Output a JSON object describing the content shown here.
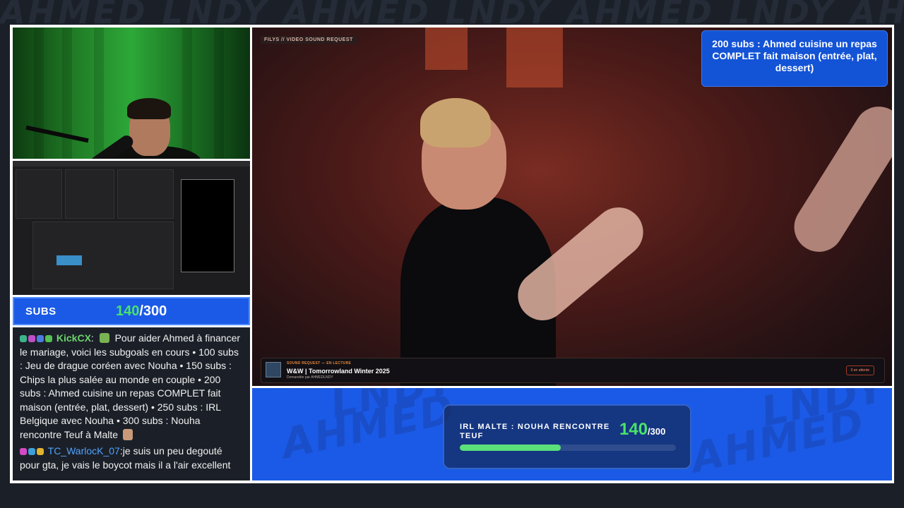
{
  "background_watermark": "AHMED LNDY AHMED LNDY AHMED LNDY AHMED",
  "video_tag": "FILYS // VIDEO SOUND REQUEST",
  "subgoal_popup": "200 subs : Ahmed cuisine un repas COMPLET fait maison (entrée, plat, dessert)",
  "song": {
    "kicker": "SOUND REQUEST — EN LECTURE",
    "title": "W&W | Tomorrowland Winter 2025",
    "requested_by": "Demandée par AHMEDLNDY",
    "status": "0 en attente"
  },
  "subs": {
    "label": "SUBS",
    "current": "140",
    "total": "/300"
  },
  "goal": {
    "label": "IRL MALTE : NOUHA RENCONTRE TEUF",
    "current": "140",
    "total": "/300",
    "progress": 0.466
  },
  "banner_watermark": [
    "AHMED",
    "LNDY",
    "AHMED",
    "LNDY"
  ],
  "chat": [
    {
      "user": "KickCX",
      "user_color": "#6cd36c",
      "text_a": "Pour aider Ahmed à financer le mariage, voici les subgoals en cours • 100 subs : Jeu de drague coréen avec Nouha • 150 subs : Chips la plus salée au monde en couple • 200 subs : Ahmed cuisine un repas COMPLET fait maison (entrée, plat, dessert) • 250 subs : IRL Belgique avec Nouha • 300 subs : Nouha rencontre Teuf à Malte"
    },
    {
      "user": "TC_WarlocK_07",
      "user_color": "#4fa3ff",
      "text_a": "je suis un peu degouté pour gta, je vais le boycot mais il a l'air excellent"
    }
  ]
}
